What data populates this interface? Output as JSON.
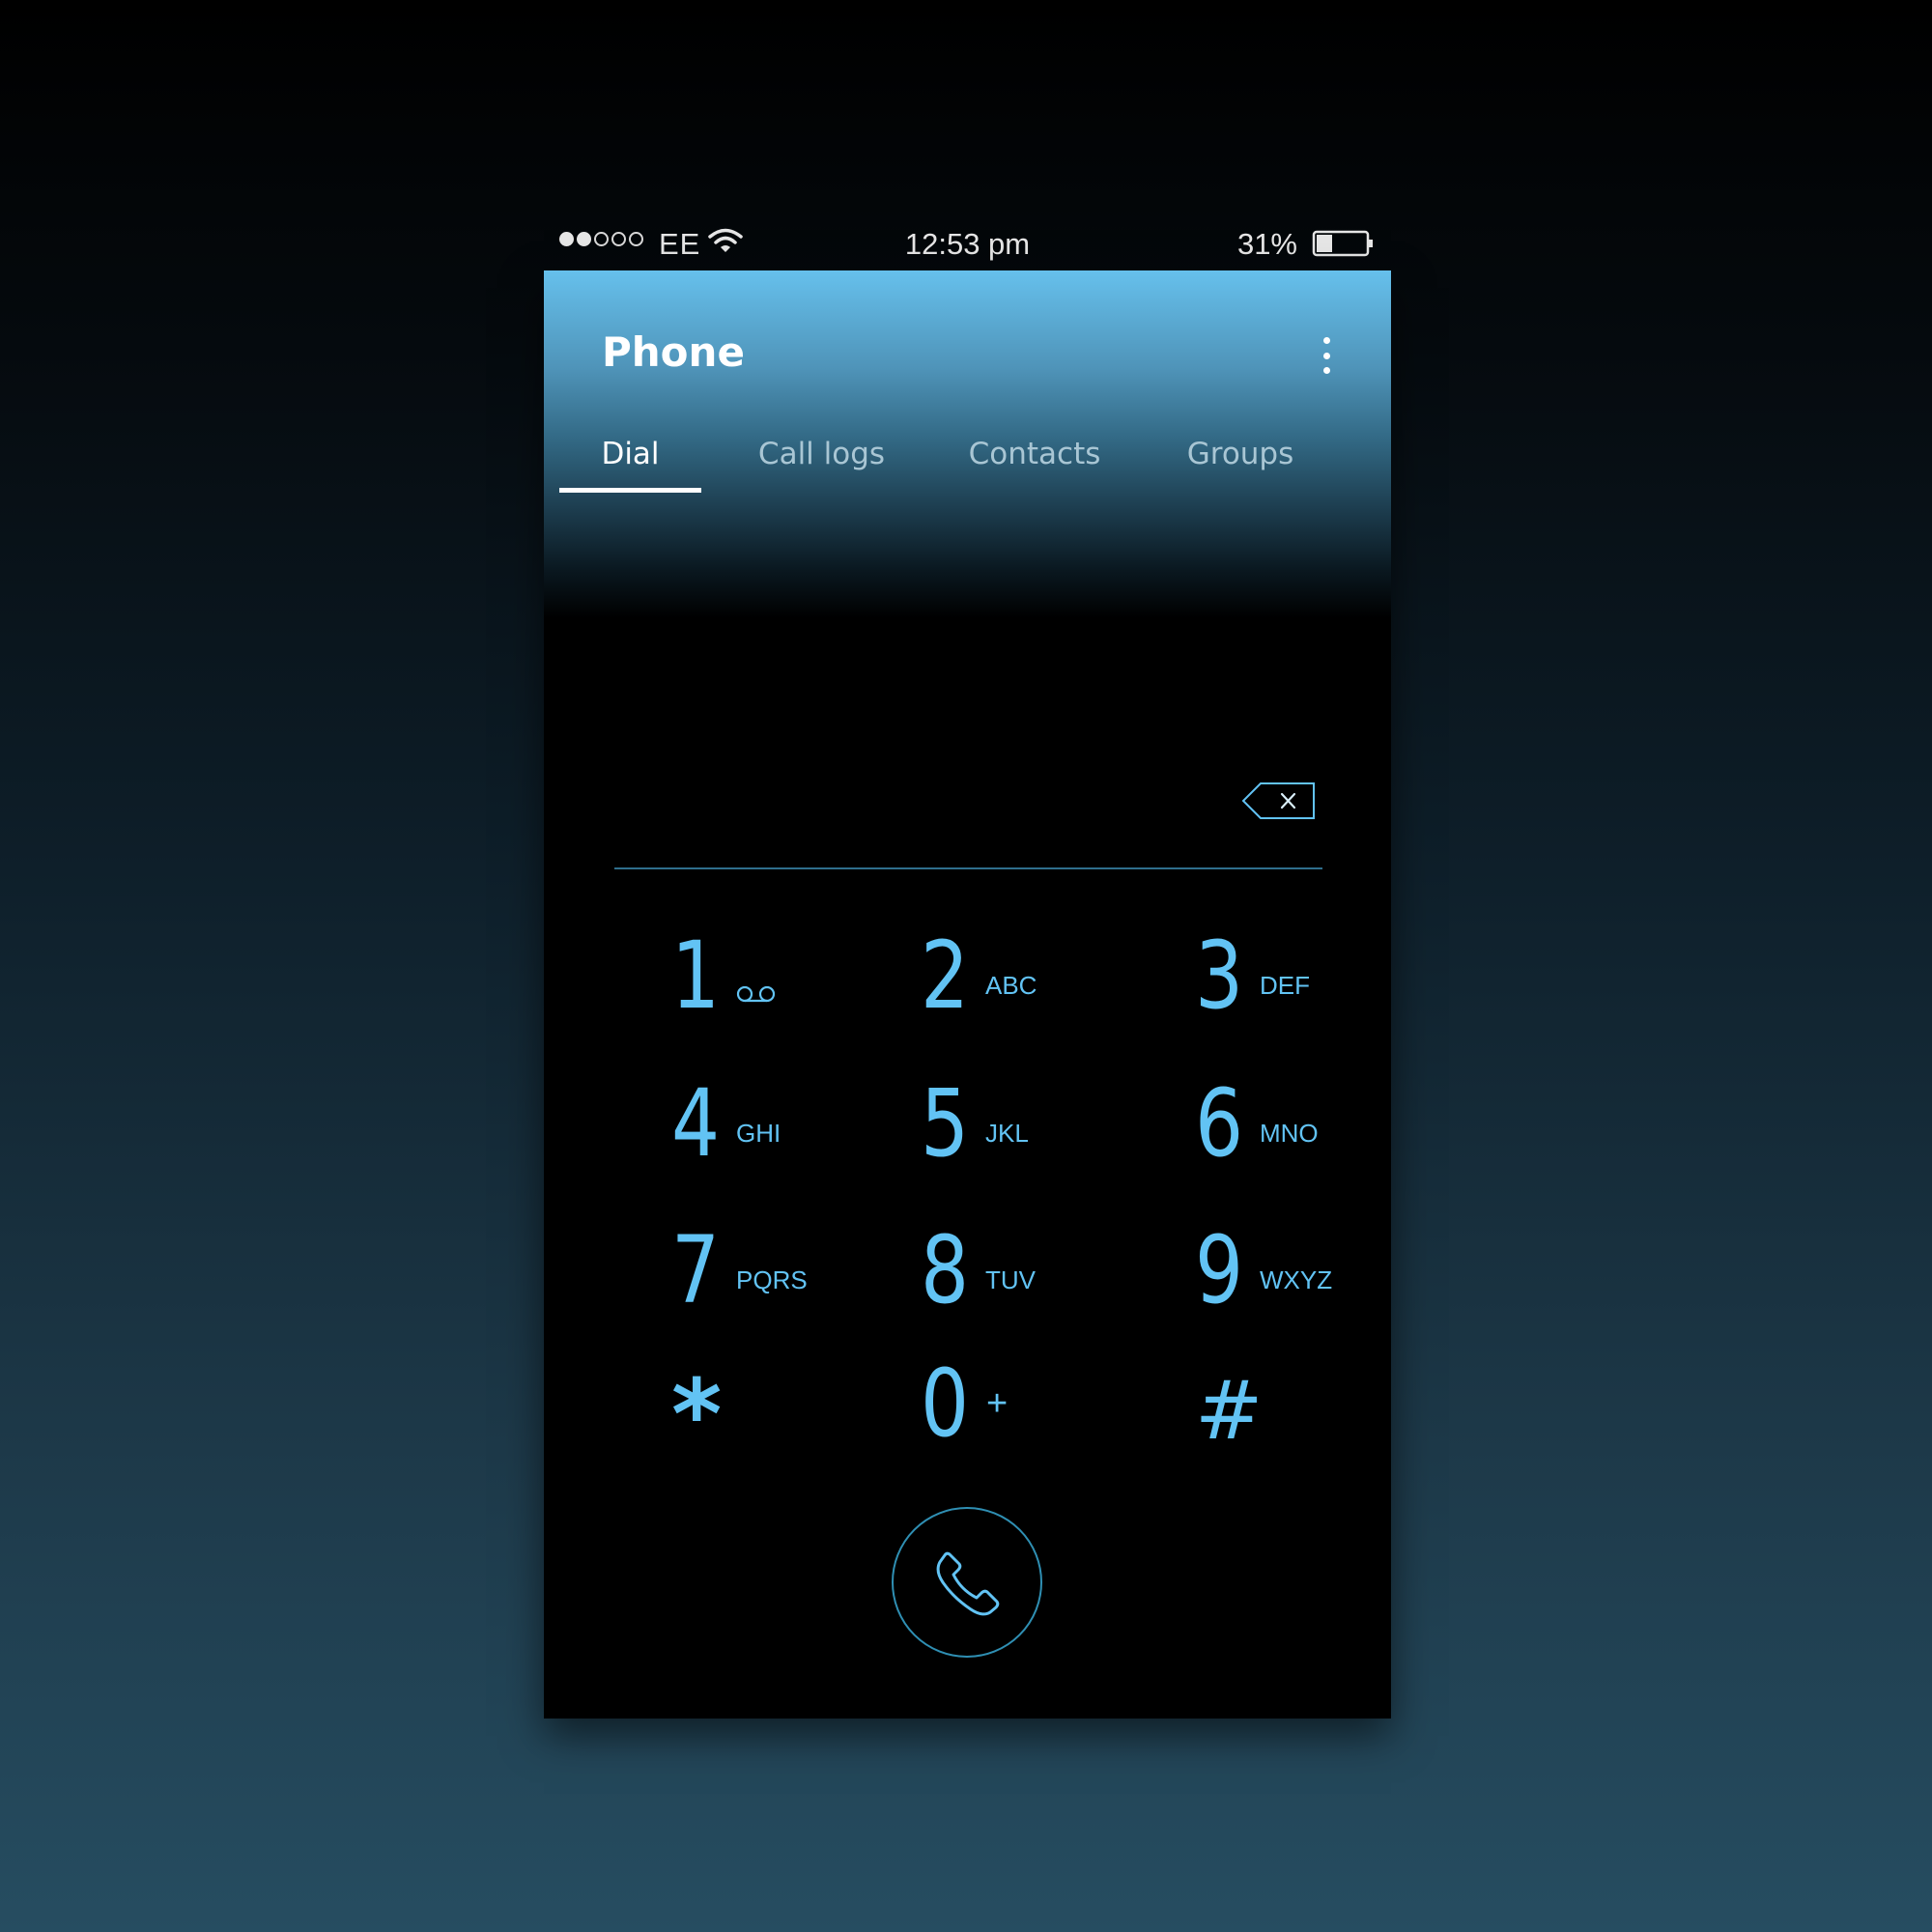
{
  "status_bar": {
    "signal_filled": 2,
    "signal_total": 5,
    "carrier": "EE",
    "time": "12:53 pm",
    "battery_percent": "31%",
    "battery_level": 0.31
  },
  "header": {
    "title": "Phone",
    "menu_icon": "more-vertical-icon"
  },
  "tabs": [
    {
      "label": "Dial",
      "active": true
    },
    {
      "label": "Call logs",
      "active": false
    },
    {
      "label": "Contacts",
      "active": false
    },
    {
      "label": "Groups",
      "active": false
    }
  ],
  "entry": {
    "value": "",
    "backspace_icon": "backspace-icon"
  },
  "keypad": {
    "keys": [
      {
        "digit": "1",
        "letters": "",
        "icon": "voicemail-icon"
      },
      {
        "digit": "2",
        "letters": "ABC"
      },
      {
        "digit": "3",
        "letters": "DEF"
      },
      {
        "digit": "4",
        "letters": "GHI"
      },
      {
        "digit": "5",
        "letters": "JKL"
      },
      {
        "digit": "6",
        "letters": "MNO"
      },
      {
        "digit": "7",
        "letters": "PQRS"
      },
      {
        "digit": "8",
        "letters": "TUV"
      },
      {
        "digit": "9",
        "letters": "WXYZ"
      },
      {
        "digit": "*",
        "letters": ""
      },
      {
        "digit": "0",
        "letters": "+"
      },
      {
        "digit": "#",
        "letters": ""
      }
    ]
  },
  "call_button": {
    "icon": "phone-icon"
  },
  "colors": {
    "accent": "#62c3f4",
    "header_top": "#66c0ec",
    "screen_bg": "#000000",
    "divider": "#2f6e8c"
  }
}
